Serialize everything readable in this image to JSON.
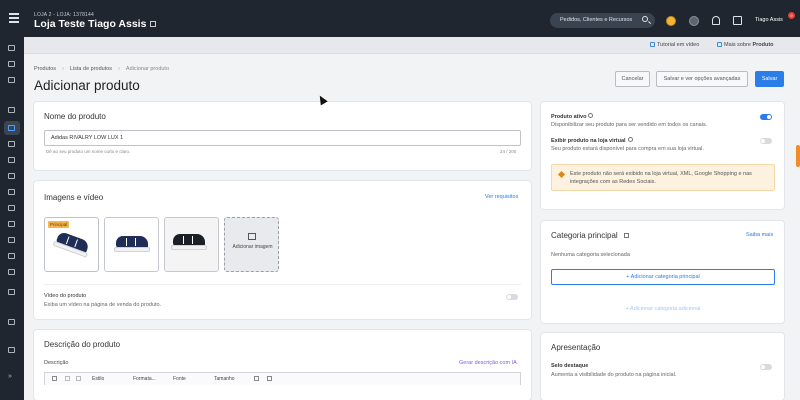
{
  "topbar": {
    "store_sub": "LOJA 2 - LOJA: 1378144",
    "store_title": "Loja Teste Tiago Assis",
    "search_placeholder": "Pedidos, Clientes e Recursos",
    "user_name": "Tiago Assis",
    "notif_count": "9"
  },
  "subheader": {
    "tutorial": "Tutorial em vídeo",
    "about_prefix": "Mais sobre",
    "about_bold": "Produto"
  },
  "breadcrumb": [
    "Produtos",
    "Lista de produtos",
    "Adicionar produto"
  ],
  "page_title": "Adicionar produto",
  "actions": {
    "cancel": "Cancelar",
    "save_more": "Salvar e ver opções avançadas",
    "save": "Salvar"
  },
  "name_card": {
    "title": "Nome do produto",
    "value": "Adidas RIVALRY LOW LUX 1",
    "hint": "Dê ao seu produto um nome curto e claro.",
    "counter": "24 / 200"
  },
  "images_card": {
    "title": "Imagens e vídeo",
    "requirements_link": "Ver requisitos",
    "principal_badge": "Principal",
    "add_image": "Adicionar imagem",
    "video_label": "Vídeo do produto",
    "video_desc": "Exiba um vídeo na página de venda do produto."
  },
  "description_card": {
    "title": "Descrição do produto",
    "label": "Descrição",
    "ai_link": "Gerar descrição com IA",
    "toolbar": [
      "Estilo",
      "Formata...",
      "Fonte",
      "Tamanho"
    ]
  },
  "status_card": {
    "active_label": "Produto ativo",
    "active_desc": "Disponibilizar seu produto para ser vendido em todos os canais.",
    "show_label": "Exibir produto na loja virtual",
    "show_desc": "Seu produto estará disponível para compra em sua loja virtual.",
    "warning": "Este produto não será exibido na loja virtual, XML, Google Shopping e nas integrações com as Redes Sociais."
  },
  "category_card": {
    "title": "Categoria principal",
    "more_link": "Saiba mais",
    "empty": "Nenhuma categoria selecionada",
    "add_main": "+ Adicionar categoria principal",
    "add_extra": "+ Adicionar categoria adicional"
  },
  "presentation_card": {
    "title": "Apresentação",
    "seal_label": "Selo destaque",
    "seal_desc": "Aumenta a visibilidade do produto na página inicial."
  },
  "colors": {
    "accent": "#2b7de9",
    "topbar": "#1f2630",
    "warning_bg": "#fdf1e0"
  }
}
